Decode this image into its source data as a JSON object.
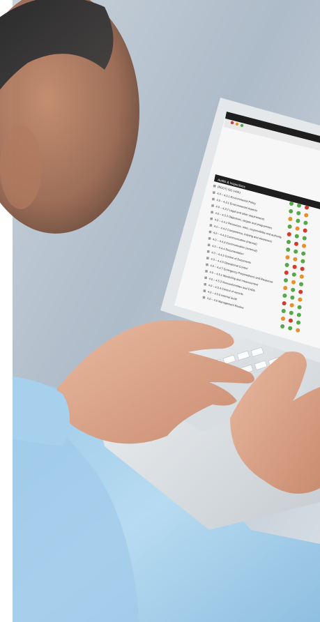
{
  "scene": {
    "description_icons": [
      "person-head",
      "hands",
      "laptop",
      "shirt"
    ]
  },
  "screen": {
    "tree_header": "Audits & Inspections",
    "items": [
      "[ROOT] ISO 14001",
      "4.0 – 4.0.1 Environmental Policy",
      "4.0 – 4.3.1 Environmental Aspects",
      "4.0 – 4.3.2 Legal and other requirements",
      "4.0 – 4.3.3 Objectives, targets and programmes",
      "4.0 – 4.4.1 Resources, roles, responsibility and authority",
      "4.0 – 4.4.2 Competence, training and awareness",
      "4.0 – 4.4.3 Communication (internal)",
      "4.0 – 4.4.3 Communication (external)",
      "4.0 – 4.4.4 Documentation",
      "4.0 – 4.4.5 Control of Documents",
      "4.0 – 4.4.6 Operational Control",
      "4.0 – 4.4.7 Emergency Preparedness and Response",
      "4.0 – 4.5.1 Monitoring and measurement",
      "4.0 – 4.5.3 Nonconformities and CAPA",
      "4.0 – 4.5.4 Control of records",
      "4.0 – 4.5.5 Internal audit",
      "4.0 – 4.6 Management Review"
    ],
    "status_colors": {
      "green": "#55a84a",
      "orange": "#e8902a",
      "red": "#d23a2a",
      "empty": "#e6e6e6"
    },
    "status_grid": [
      [
        "green",
        "green",
        "red"
      ],
      [
        "green",
        "green",
        "orange"
      ],
      [
        "orange",
        "green",
        "green"
      ],
      [
        "green",
        "orange",
        "red"
      ],
      [
        "red",
        "green",
        "green"
      ],
      [
        "green",
        "red",
        "orange"
      ],
      [
        "green",
        "green",
        "green"
      ],
      [
        "orange",
        "orange",
        "green"
      ],
      [
        "green",
        "red",
        "red"
      ],
      [
        "red",
        "green",
        "orange"
      ],
      [
        "green",
        "orange",
        "green"
      ],
      [
        "orange",
        "green",
        "red"
      ],
      [
        "green",
        "green",
        "orange"
      ],
      [
        "red",
        "orange",
        "green"
      ],
      [
        "green",
        "green",
        "green"
      ],
      [
        "orange",
        "red",
        "green"
      ],
      [
        "green",
        "green",
        "orange"
      ]
    ]
  }
}
